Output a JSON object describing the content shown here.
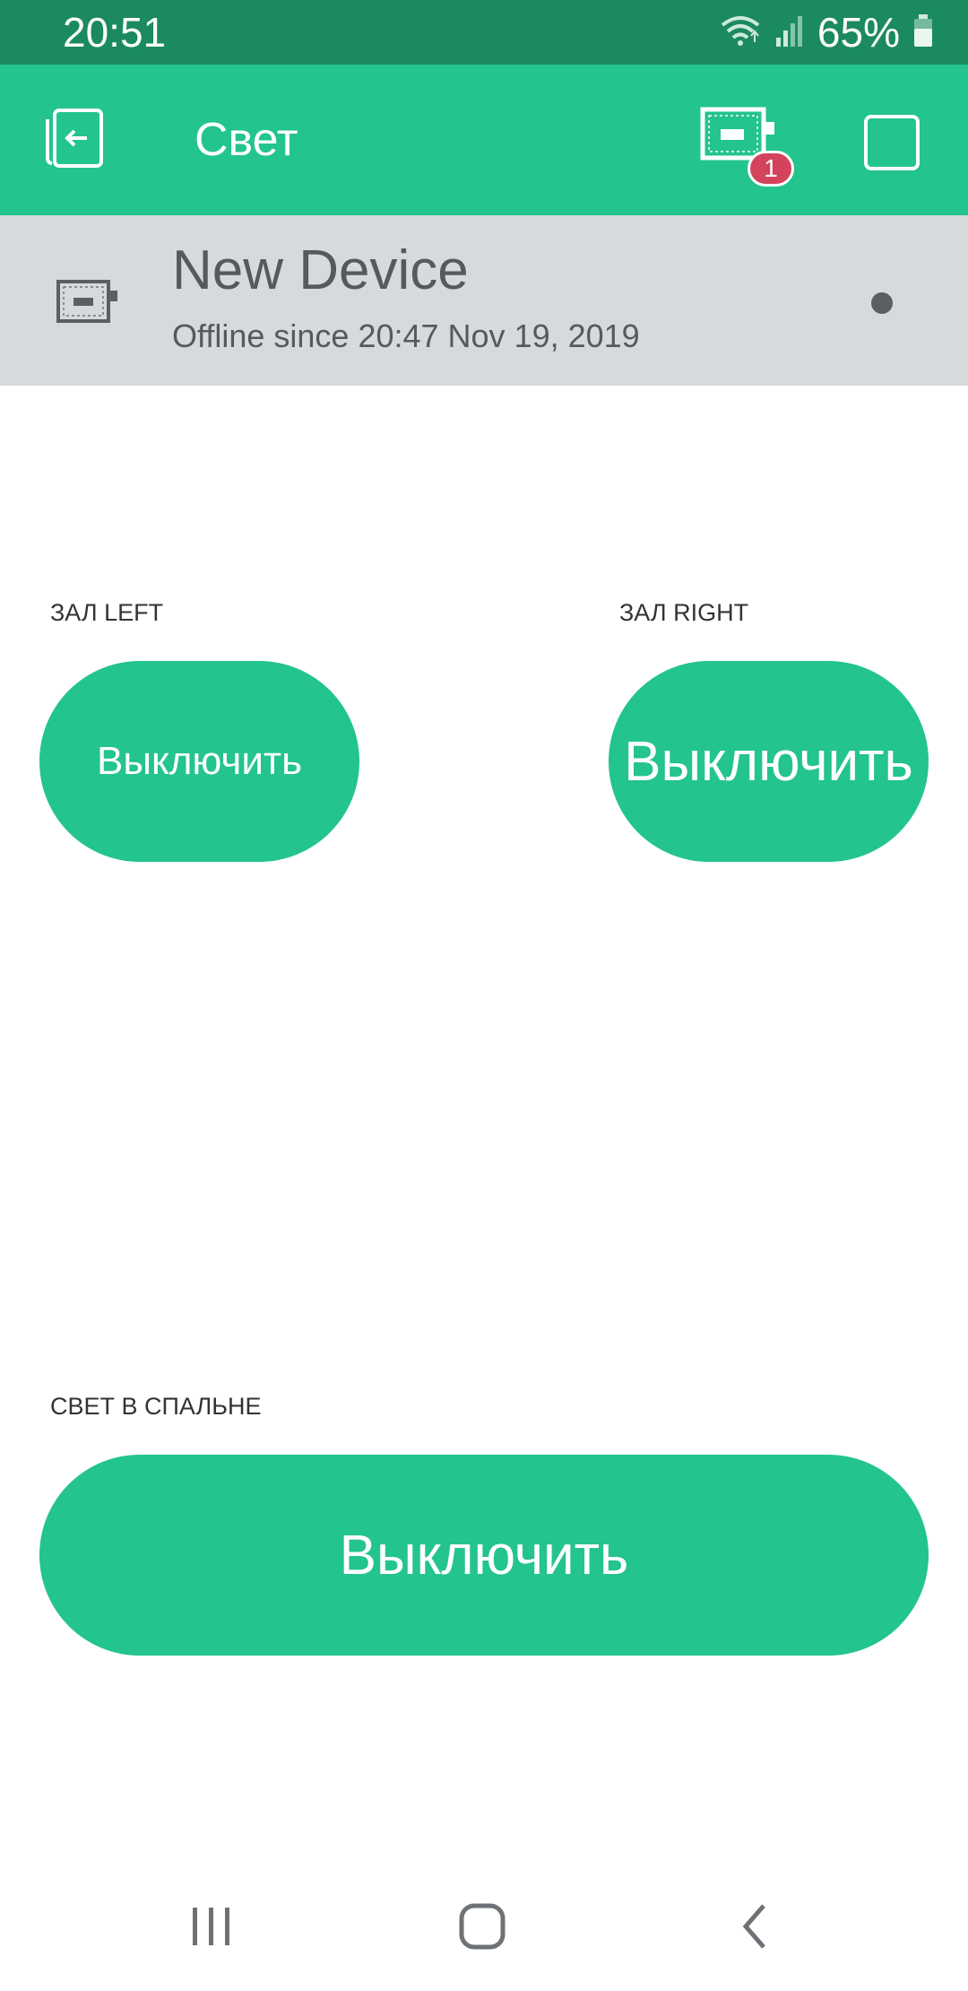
{
  "status_bar": {
    "time": "20:51",
    "battery": "65%"
  },
  "app_bar": {
    "title": "Свет",
    "badge_count": "1",
    "color": "#23c48e"
  },
  "device": {
    "name": "New Device",
    "status": "Offline since 20:47 Nov 19, 2019"
  },
  "widgets": {
    "left": {
      "label": "ЗАЛ LEFT",
      "button": "Выключить"
    },
    "right": {
      "label": "ЗАЛ RIGHT",
      "button": "Выключить"
    },
    "bedroom": {
      "label": "СВЕТ В СПАЛЬНЕ",
      "button": "Выключить"
    }
  },
  "icons": {
    "back": "exit-project-icon",
    "devices": "device-board-icon",
    "square": "square-icon",
    "wifi": "wifi-icon",
    "signal": "signal-icon",
    "battery": "battery-icon",
    "nav_recent": "recent-apps-icon",
    "nav_home": "home-icon",
    "nav_back": "back-chevron-icon"
  }
}
